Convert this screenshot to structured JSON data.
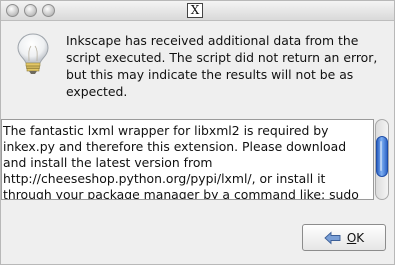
{
  "window": {
    "title_icon": "x11-icon"
  },
  "dialog": {
    "icon": "lightbulb-icon",
    "message": "Inkscape has received additional data from the\nscript executed.  The script did not return an error,\nbut this may indicate the results will not be as\nexpected.",
    "detail_text": "The fantastic lxml wrapper for libxml2 is required by inkex.py and therefore this extension. Please download and install the latest version from http://cheeseshop.python.org/pypi/lxml/, or install it through your package manager by a command like: sudo apt-get",
    "ok_button": {
      "label_mnemonic": "O",
      "label_rest": "K",
      "icon": "back-arrow-icon"
    }
  },
  "colors": {
    "scrollbar_thumb": "#4a86dc",
    "window_background": "#efefef"
  }
}
